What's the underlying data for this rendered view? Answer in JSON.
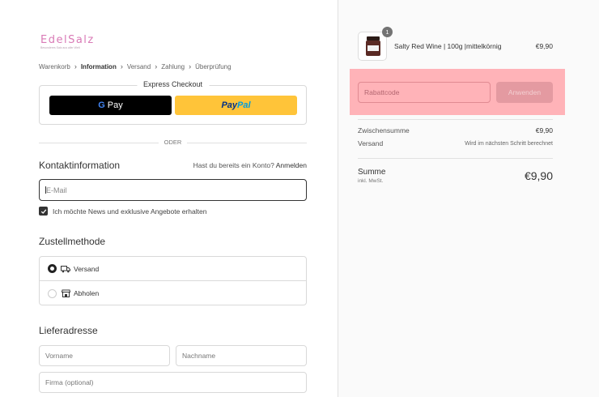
{
  "brand": {
    "name": "EdelSalz",
    "tagline": "Besonderes Salz aus aller Welt"
  },
  "breadcrumb": [
    {
      "label": "Warenkorb"
    },
    {
      "label": "Information",
      "active": true
    },
    {
      "label": "Versand"
    },
    {
      "label": "Zahlung"
    },
    {
      "label": "Überprüfung"
    }
  ],
  "express": {
    "title": "Express Checkout",
    "gpay_g": "G",
    "gpay_label": "Pay",
    "paypal_a": "Pay",
    "paypal_b": "Pal"
  },
  "divider_text": "ODER",
  "contact": {
    "heading": "Kontaktinformation",
    "account_prompt": "Hast du bereits ein Konto?",
    "login_link": "Anmelden",
    "email_placeholder": "E-Mail",
    "newsletter_label": "Ich möchte News und exklusive Angebote erhalten",
    "newsletter_checked": true
  },
  "delivery": {
    "heading": "Zustellmethode",
    "options": [
      {
        "label": "Versand",
        "selected": true,
        "icon": "truck-icon"
      },
      {
        "label": "Abholen",
        "selected": false,
        "icon": "store-icon"
      }
    ]
  },
  "address": {
    "heading": "Lieferadresse",
    "first_name_placeholder": "Vorname",
    "last_name_placeholder": "Nachname",
    "company_placeholder": "Firma (optional)"
  },
  "cart": {
    "item": {
      "name": "Salty Red Wine | 100g |mittelkörnig",
      "price": "€9,90",
      "quantity": "1"
    },
    "discount_placeholder": "Rabattcode",
    "apply_label": "Anwenden",
    "subtotal_label": "Zwischensumme",
    "subtotal_value": "€9,90",
    "shipping_label": "Versand",
    "shipping_value": "Wird im nächsten Schritt berechnet",
    "total_label": "Summe",
    "tax_note": "inkl. MwSt.",
    "total_value": "€9,90"
  },
  "colors": {
    "highlight": "#ffb3b8",
    "paypal_yellow": "#ffc439",
    "brand_pink": "#d97ab6"
  }
}
